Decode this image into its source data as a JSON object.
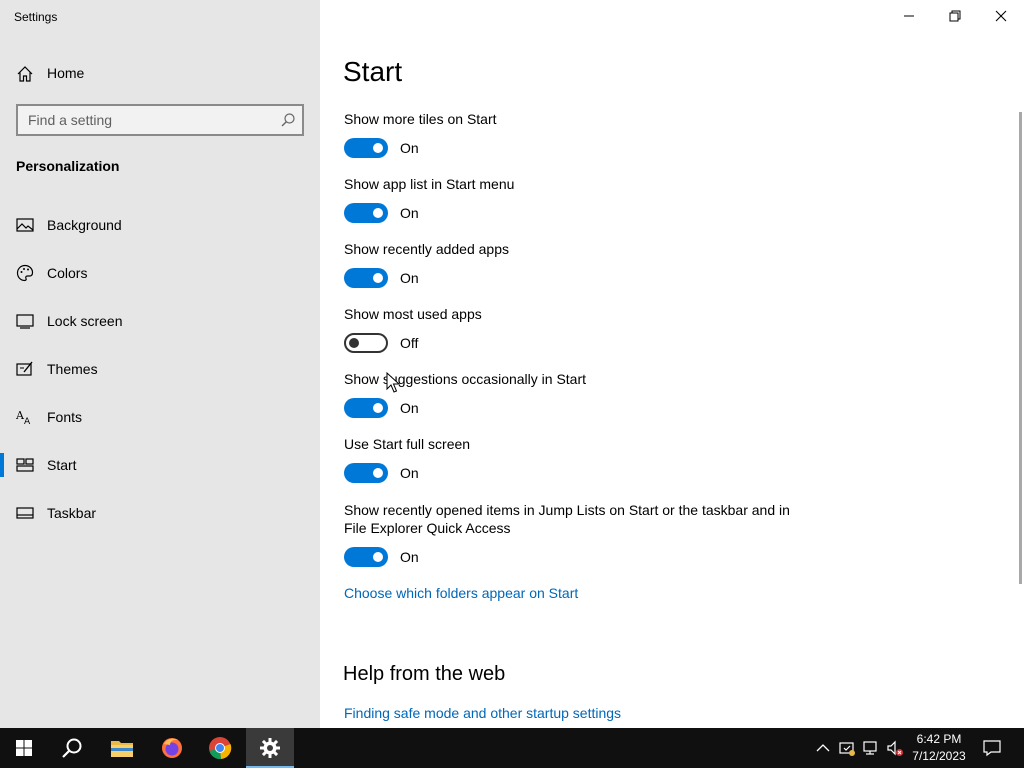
{
  "window": {
    "title": "Settings"
  },
  "sidebar": {
    "home_label": "Home",
    "search_placeholder": "Find a setting",
    "section_title": "Personalization",
    "items": [
      {
        "label": "Background",
        "icon": "image-icon"
      },
      {
        "label": "Colors",
        "icon": "palette-icon"
      },
      {
        "label": "Lock screen",
        "icon": "lock-screen-icon"
      },
      {
        "label": "Themes",
        "icon": "themes-icon"
      },
      {
        "label": "Fonts",
        "icon": "fonts-icon"
      },
      {
        "label": "Start",
        "icon": "start-icon",
        "active": true
      },
      {
        "label": "Taskbar",
        "icon": "taskbar-icon"
      }
    ]
  },
  "main": {
    "title": "Start",
    "settings": [
      {
        "label": "Show more tiles on Start",
        "state": "On"
      },
      {
        "label": "Show app list in Start menu",
        "state": "On"
      },
      {
        "label": "Show recently added apps",
        "state": "On"
      },
      {
        "label": "Show most used apps",
        "state": "Off"
      },
      {
        "label": "Show suggestions occasionally in Start",
        "state": "On"
      },
      {
        "label": "Use Start full screen",
        "state": "On"
      },
      {
        "label": "Show recently opened items in Jump Lists on Start or the taskbar and in File Explorer Quick Access",
        "state": "On"
      }
    ],
    "folders_link": "Choose which folders appear on Start",
    "help_title": "Help from the web",
    "help_link": "Finding safe mode and other startup settings"
  },
  "taskbar": {
    "time": "6:42 PM",
    "date": "7/12/2023",
    "pinned": [
      "start-button",
      "search-button",
      "file-explorer",
      "firefox",
      "chrome",
      "settings"
    ]
  },
  "colors": {
    "accent": "#0078d7",
    "link": "#0067b8",
    "sidebar_bg": "#e6e6e6",
    "taskbar_bg": "#101010"
  }
}
